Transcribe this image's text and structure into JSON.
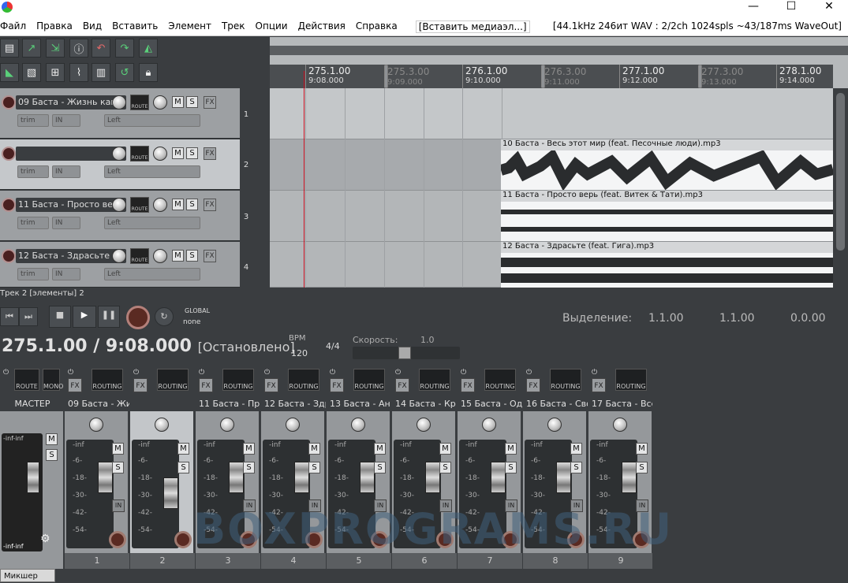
{
  "menubar": {
    "items": [
      "Файл",
      "Правка",
      "Вид",
      "Вставить",
      "Элемент",
      "Трек",
      "Опции",
      "Действия",
      "Справка"
    ],
    "insert_media": "[Вставить медиаэл...]",
    "status": "[44.1kHz 246ит WAV : 2/2ch 1024spls ~43/187ms WaveOut]"
  },
  "window": {
    "minimize": "—",
    "maximize": "☐",
    "close": "✕"
  },
  "ruler": {
    "marks": [
      {
        "bar": "275.1.00",
        "time": "9:08.000",
        "major": true
      },
      {
        "bar": "275.3.00",
        "time": "9:09.000",
        "major": false
      },
      {
        "bar": "276.1.00",
        "time": "9:10.000",
        "major": true
      },
      {
        "bar": "276.3.00",
        "time": "9:11.000",
        "major": false
      },
      {
        "bar": "277.1.00",
        "time": "9:12.000",
        "major": true
      },
      {
        "bar": "277.3.00",
        "time": "9:13.000",
        "major": false
      },
      {
        "bar": "278.1.00",
        "time": "9:14.000",
        "major": true
      }
    ]
  },
  "tracks": [
    {
      "name": "09 Баста - Жизнь как",
      "num": "1",
      "item": ""
    },
    {
      "name": "",
      "num": "2",
      "item": "10 Баста - Весь этот мир (feat. Песочные люди).mp3"
    },
    {
      "name": "11 Баста - Просто вер",
      "num": "3",
      "item": "11 Баста - Просто верь (feat. Витек & Тати).mp3"
    },
    {
      "name": "12 Баста - Здрасьте (",
      "num": "4",
      "item": "12 Баста - Здрасьте (feat. Гига).mp3"
    }
  ],
  "tcp_labels": {
    "mute": "M",
    "solo": "S",
    "fx": "FX",
    "route": "ROUTE",
    "trim": "trim",
    "in": "IN",
    "left": "Left"
  },
  "track_info": "Трек 2 [элементы] 2",
  "transport": {
    "global": "GLOBAL",
    "none": "none",
    "time": "275.1.00 / 9:08.000",
    "state": "[Остановлено]",
    "bpm_label": "BPM",
    "bpm": "120",
    "sig": "4/4",
    "rate_label": "Скорость:",
    "rate": "1.0"
  },
  "selection": {
    "label": "Выделение:",
    "start": "1.1.00",
    "end": "1.1.00",
    "length": "0.0.00"
  },
  "mixer": {
    "master": {
      "name": "МАСТЕР",
      "route": "ROUTE",
      "mono": "MONO",
      "meter_top": "-inf-inf",
      "meter_bottom": "-inf-inf"
    },
    "routing": "ROUTING",
    "strips": [
      {
        "name": "09 Баста - Жи",
        "num": "1"
      },
      {
        "name": "",
        "num": "2"
      },
      {
        "name": "11 Баста - Пр",
        "num": "3"
      },
      {
        "name": "12 Баста - Здр",
        "num": "4"
      },
      {
        "name": "13 Баста - Ан",
        "num": "5"
      },
      {
        "name": "14 Баста - Кр",
        "num": "6"
      },
      {
        "name": "15 Баста - Од",
        "num": "7"
      },
      {
        "name": "16 Баста - Сво",
        "num": "8"
      },
      {
        "name": "17 Баста - Все",
        "num": "9"
      }
    ],
    "db_scale": [
      "-inf",
      "-6-",
      "-18-",
      "-30-",
      "-42-",
      "-54-"
    ],
    "in": "IN",
    "tab": "Микшер"
  },
  "watermark": "BOXPROGRAMS.RU"
}
